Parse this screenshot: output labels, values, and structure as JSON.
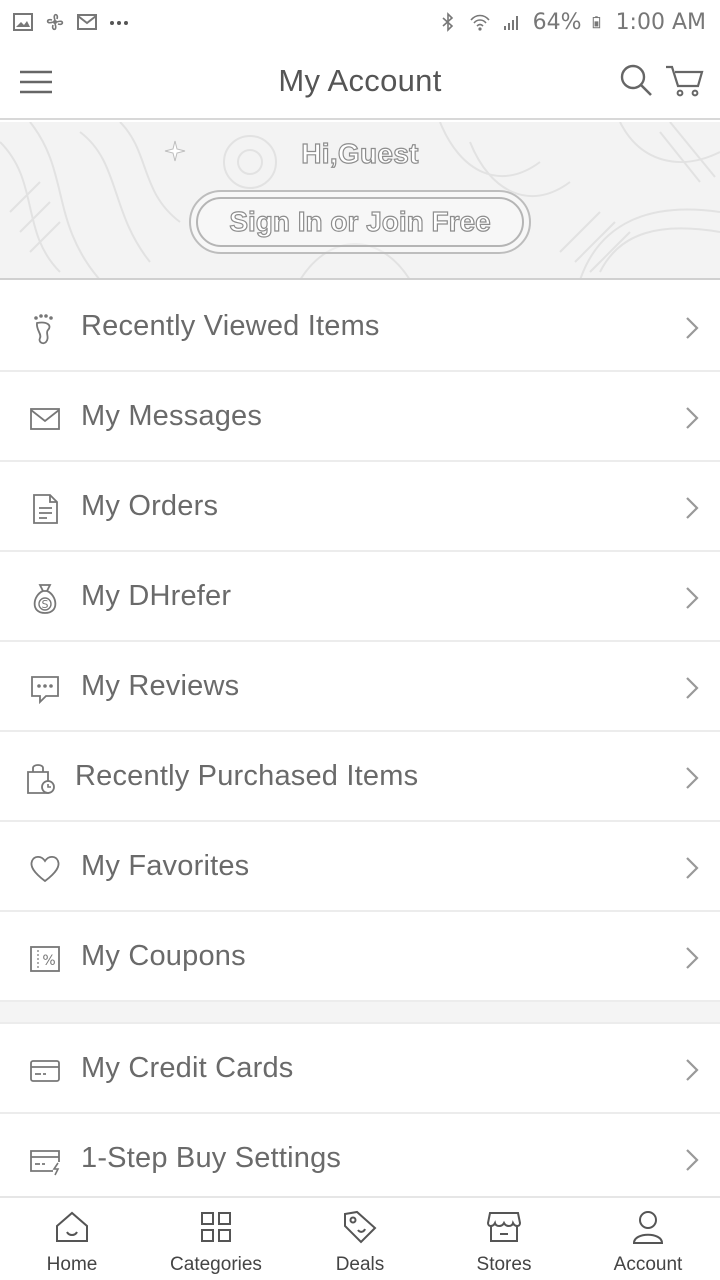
{
  "status_bar": {
    "battery": "64%",
    "time": "1:00 AM",
    "icons": [
      "gallery-icon",
      "fan-icon",
      "gmail-icon",
      "more-icon",
      "bluetooth-icon",
      "wifi-icon",
      "signal-icon",
      "battery-icon"
    ]
  },
  "header": {
    "title": "My Account",
    "icons": [
      "menu-icon",
      "search-icon",
      "cart-icon"
    ]
  },
  "banner": {
    "greeting": "Hi,Guest",
    "sign_in_label": "Sign In or Join Free"
  },
  "menu": {
    "items": [
      {
        "label": "Recently Viewed Items",
        "icon": "footprint-icon"
      },
      {
        "label": "My Messages",
        "icon": "envelope-icon"
      },
      {
        "label": "My Orders",
        "icon": "document-icon"
      },
      {
        "label": "My DHrefer",
        "icon": "money-bag-icon"
      },
      {
        "label": "My Reviews",
        "icon": "chat-bubble-icon"
      },
      {
        "label": "Recently Purchased Items",
        "icon": "shopping-bag-clock-icon"
      },
      {
        "label": "My Favorites",
        "icon": "heart-icon"
      },
      {
        "label": "My Coupons",
        "icon": "coupon-icon"
      },
      {
        "label": "My Credit Cards",
        "icon": "credit-card-icon"
      },
      {
        "label": "1-Step Buy Settings",
        "icon": "quick-buy-card-icon"
      }
    ]
  },
  "bottom_nav": {
    "items": [
      {
        "label": "Home",
        "icon": "home-icon"
      },
      {
        "label": "Categories",
        "icon": "grid-icon"
      },
      {
        "label": "Deals",
        "icon": "tag-icon"
      },
      {
        "label": "Stores",
        "icon": "store-icon"
      },
      {
        "label": "Account",
        "icon": "person-icon"
      }
    ]
  },
  "colors": {
    "text": "#6a6a6a",
    "divider": "#ececec",
    "banner_bg": "#f3f3f3"
  }
}
